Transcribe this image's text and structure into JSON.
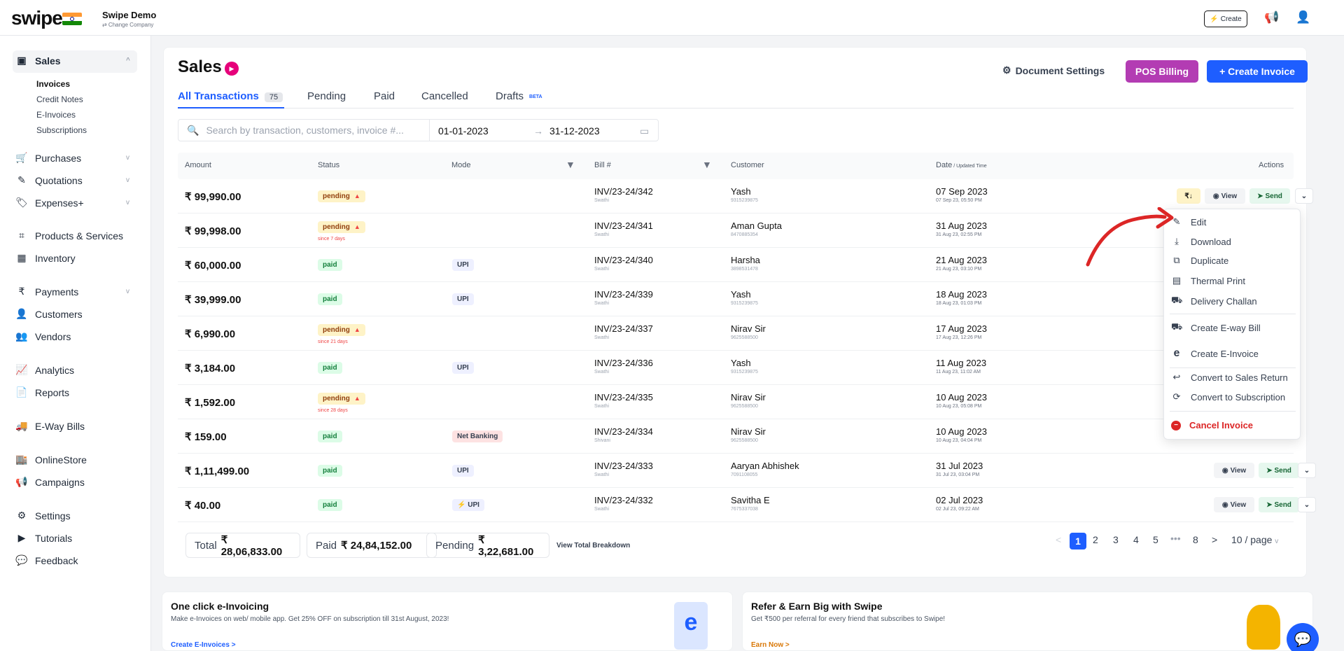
{
  "brand": {
    "logo": "swipe",
    "company": "Swipe Demo",
    "change": "⇄ Change Company"
  },
  "topbar": {
    "create": "Create",
    "lightning": "⚡",
    "megaphone": "📢",
    "user": "👤"
  },
  "sidebar": {
    "sales": "Sales",
    "sub": [
      "Invoices",
      "Credit Notes",
      "E-Invoices",
      "Subscriptions"
    ],
    "items": [
      {
        "label": "Purchases",
        "icon": "cart-icon",
        "glyph": "🛒"
      },
      {
        "label": "Quotations",
        "icon": "pen-icon",
        "glyph": "✎"
      },
      {
        "label": "Expenses+",
        "icon": "tag-icon",
        "glyph": "🏷"
      },
      {
        "label": "Products & Services",
        "icon": "box-icon",
        "glyph": "⌗"
      },
      {
        "label": "Inventory",
        "icon": "warehouse-icon",
        "glyph": "▦"
      },
      {
        "label": "Payments",
        "icon": "rupee-icon",
        "glyph": "₹"
      },
      {
        "label": "Customers",
        "icon": "person-icon",
        "glyph": "👤"
      },
      {
        "label": "Vendors",
        "icon": "people-icon",
        "glyph": "👥"
      },
      {
        "label": "Analytics",
        "icon": "chart-icon",
        "glyph": "📈"
      },
      {
        "label": "Reports",
        "icon": "report-icon",
        "glyph": "📄"
      },
      {
        "label": "E-Way Bills",
        "icon": "truck-icon",
        "glyph": "🚚"
      },
      {
        "label": "OnlineStore",
        "icon": "store-icon",
        "glyph": "🏬"
      },
      {
        "label": "Campaigns",
        "icon": "megaphone-icon",
        "glyph": "📢"
      },
      {
        "label": "Settings",
        "icon": "gear-icon",
        "glyph": "⚙"
      },
      {
        "label": "Tutorials",
        "icon": "youtube-icon",
        "glyph": "▶"
      },
      {
        "label": "Feedback",
        "icon": "chat-icon",
        "glyph": "💬"
      }
    ]
  },
  "header": {
    "title": "Sales",
    "doc_settings": "Document Settings",
    "pos": "POS Billing",
    "create": "+ Create Invoice"
  },
  "tabs": {
    "all": "All Transactions",
    "count": "75",
    "pending": "Pending",
    "paid": "Paid",
    "cancelled": "Cancelled",
    "drafts": "Drafts",
    "beta": "BETA"
  },
  "search": {
    "placeholder": "Search by transaction, customers, invoice #...",
    "from": "01-01-2023",
    "to": "31-12-2023"
  },
  "columns": {
    "amount": "Amount",
    "status": "Status",
    "mode": "Mode",
    "bill": "Bill #",
    "customer": "Customer",
    "date": "Date",
    "updated": " / Updated Time",
    "actions": "Actions"
  },
  "rows": [
    {
      "amount": "₹ 99,990.00",
      "status": "pending",
      "since": "",
      "mode": "",
      "bill": "INV/23-24/342",
      "bill_s": "Swathi",
      "cust": "Yash",
      "cust_s": "9315239875",
      "date": "07 Sep 2023",
      "date_s": "07 Sep 23, 05:50 PM"
    },
    {
      "amount": "₹ 99,998.00",
      "status": "pending",
      "since": "since 7 days",
      "mode": "",
      "bill": "INV/23-24/341",
      "bill_s": "Swathi",
      "cust": "Aman Gupta",
      "cust_s": "8470885354",
      "date": "31 Aug 2023",
      "date_s": "31 Aug 23, 02:55 PM"
    },
    {
      "amount": "₹ 60,000.00",
      "status": "paid",
      "since": "",
      "mode": "UPI",
      "bill": "INV/23-24/340",
      "bill_s": "Swathi",
      "cust": "Harsha",
      "cust_s": "3898531478",
      "date": "21 Aug 2023",
      "date_s": "21 Aug 23, 03:10 PM"
    },
    {
      "amount": "₹ 39,999.00",
      "status": "paid",
      "since": "",
      "mode": "UPI",
      "bill": "INV/23-24/339",
      "bill_s": "Swathi",
      "cust": "Yash",
      "cust_s": "9315239875",
      "date": "18 Aug 2023",
      "date_s": "18 Aug 23, 01:03 PM"
    },
    {
      "amount": "₹ 6,990.00",
      "status": "pending",
      "since": "since 21 days",
      "mode": "",
      "bill": "INV/23-24/337",
      "bill_s": "Swathi",
      "cust": "Nirav Sir",
      "cust_s": "9625588500",
      "date": "17 Aug 2023",
      "date_s": "17 Aug 23, 12:26 PM"
    },
    {
      "amount": "₹ 3,184.00",
      "status": "paid",
      "since": "",
      "mode": "UPI",
      "bill": "INV/23-24/336",
      "bill_s": "Swathi",
      "cust": "Yash",
      "cust_s": "9315239875",
      "date": "11 Aug 2023",
      "date_s": "11 Aug 23, 11:02 AM"
    },
    {
      "amount": "₹ 1,592.00",
      "status": "pending",
      "since": "since 28 days",
      "mode": "",
      "bill": "INV/23-24/335",
      "bill_s": "Swathi",
      "cust": "Nirav Sir",
      "cust_s": "9625588500",
      "date": "10 Aug 2023",
      "date_s": "10 Aug 23, 05:08 PM"
    },
    {
      "amount": "₹ 159.00",
      "status": "paid",
      "since": "",
      "mode": "Net Banking",
      "bill": "INV/23-24/334",
      "bill_s": "Shivani",
      "cust": "Nirav Sir",
      "cust_s": "9625588500",
      "date": "10 Aug 2023",
      "date_s": "10 Aug 23, 04:04 PM"
    },
    {
      "amount": "₹ 1,11,499.00",
      "status": "paid",
      "since": "",
      "mode": "UPI",
      "bill": "INV/23-24/333",
      "bill_s": "Swathi",
      "cust": "Aaryan Abhishek",
      "cust_s": "7091108055",
      "date": "31 Jul 2023",
      "date_s": "31 Jul 23, 03:04 PM"
    },
    {
      "amount": "₹ 40.00",
      "status": "paid",
      "since": "",
      "mode": "⚡ UPI",
      "bill": "INV/23-24/332",
      "bill_s": "Swathi",
      "cust": "Savitha E",
      "cust_s": "7675337038",
      "date": "02 Jul 2023",
      "date_s": "02 Jul 23, 09:22 AM"
    }
  ],
  "actions": {
    "view": "View",
    "send": "Send",
    "rupee": "₹↓"
  },
  "dropdown": [
    "Edit",
    "Download",
    "Duplicate",
    "Thermal Print",
    "Delivery Challan",
    "Create E-way Bill",
    "Create E-Invoice",
    "Convert to Sales Return",
    "Convert to Subscription",
    "Cancel Invoice"
  ],
  "totals": {
    "total_l": "Total",
    "total": "₹ 28,06,833.00",
    "paid_l": "Paid",
    "paid": "₹ 24,84,152.00",
    "pending_l": "Pending",
    "pending": "₹ 3,22,681.00",
    "breakdown": "View Total Breakdown"
  },
  "pagination": {
    "pages": [
      "1",
      "2",
      "3",
      "4",
      "5",
      "•••",
      "8"
    ],
    "per": "10 / page"
  },
  "promos": [
    {
      "title": "One click e-Invoicing",
      "desc": "Make e-Invoices on web/ mobile app. Get 25% OFF on subscription till 31st August, 2023!",
      "link": "Create E-Invoices  >"
    },
    {
      "title": "Refer & Earn Big with Swipe",
      "desc": "Get ₹500 per referral for every friend that subscribes to Swipe!",
      "link": "Earn Now  >"
    }
  ],
  "colors": {
    "accent": "#1e5eff",
    "pos": "#b33cb3",
    "annotation": "#dc2626"
  }
}
